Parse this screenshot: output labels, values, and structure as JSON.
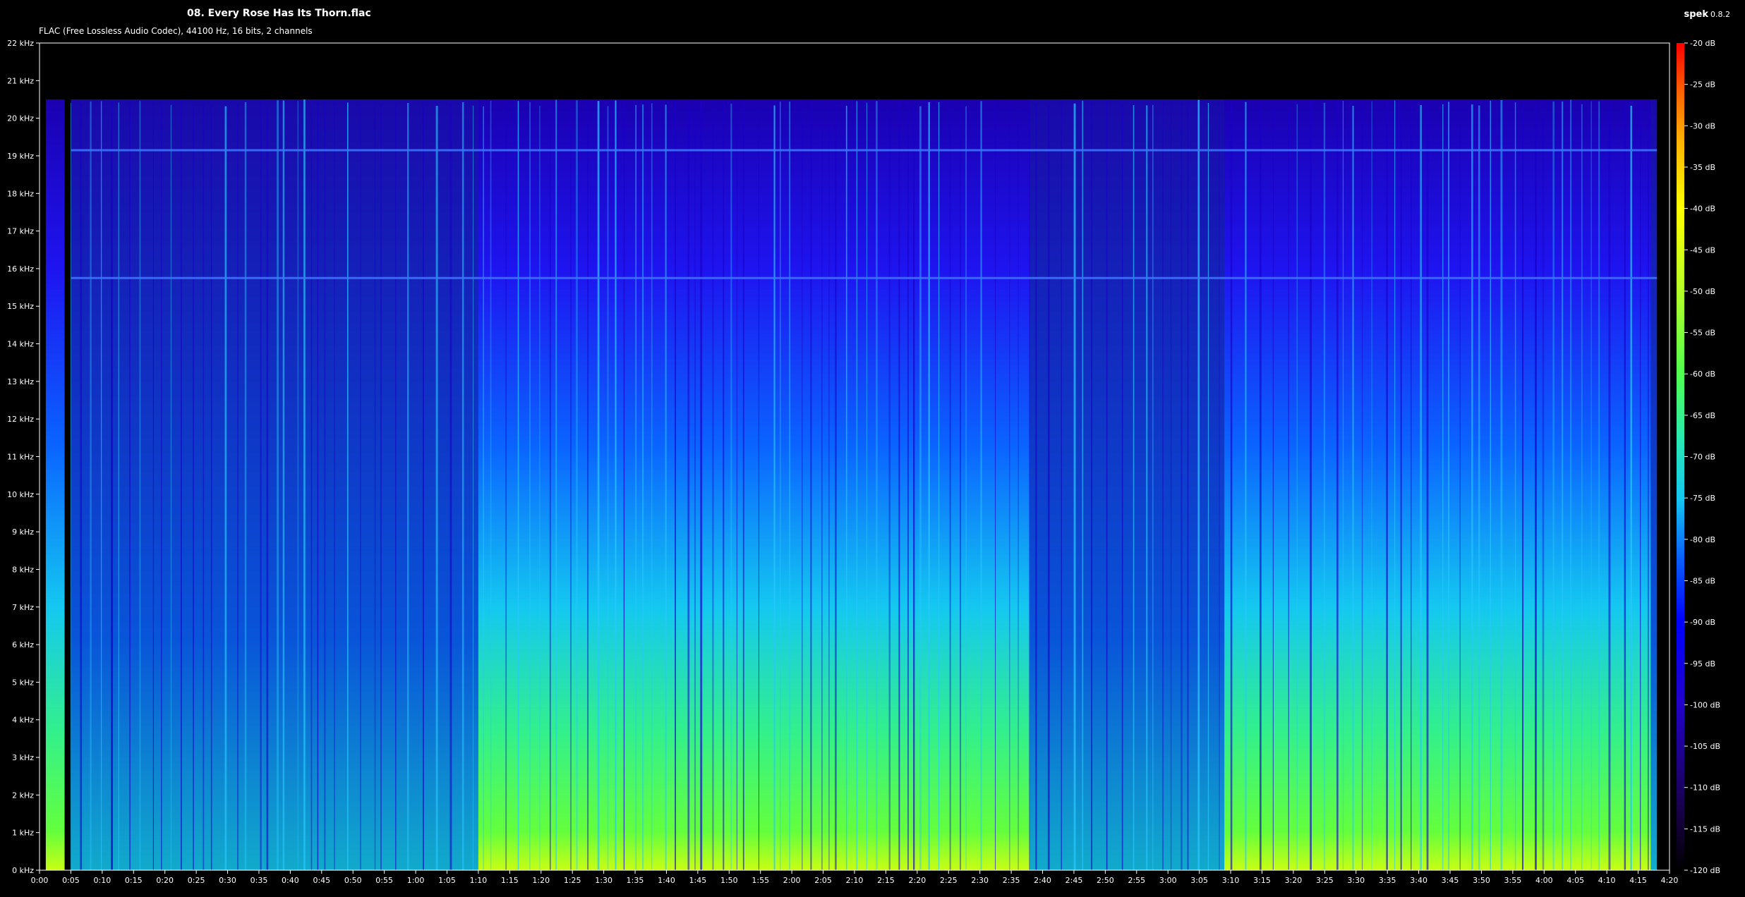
{
  "file_title": "08. Every Rose Has Its Thorn.flac",
  "file_info": "FLAC (Free Lossless Audio Codec), 44100 Hz, 16 bits, 2 channels",
  "app": {
    "name": "spek",
    "version": "0.8.2"
  },
  "colors": {
    "background": "#000000",
    "axis": "#ffffff"
  },
  "chart_data": {
    "type": "heatmap",
    "x_unit": "seconds",
    "x_ticks": [
      "0:00",
      "0:05",
      "0:10",
      "0:15",
      "0:20",
      "0:25",
      "0:30",
      "0:35",
      "0:40",
      "0:45",
      "0:50",
      "0:55",
      "1:00",
      "1:05",
      "1:10",
      "1:15",
      "1:20",
      "1:25",
      "1:30",
      "1:35",
      "1:40",
      "1:45",
      "1:50",
      "1:55",
      "2:00",
      "2:05",
      "2:10",
      "2:15",
      "2:20",
      "2:25",
      "2:30",
      "2:35",
      "2:40",
      "2:45",
      "2:50",
      "2:55",
      "3:00",
      "3:05",
      "3:10",
      "3:15",
      "3:20",
      "3:25",
      "3:30",
      "3:35",
      "3:40",
      "3:45",
      "3:50",
      "3:55",
      "4:00",
      "4:05",
      "4:10",
      "4:15",
      "4:20"
    ],
    "xlim": [
      0,
      260
    ],
    "y_ticks": [
      "0 kHz",
      "1 kHz",
      "2 kHz",
      "3 kHz",
      "4 kHz",
      "5 kHz",
      "6 kHz",
      "7 kHz",
      "8 kHz",
      "9 kHz",
      "10 kHz",
      "11 kHz",
      "12 kHz",
      "13 kHz",
      "14 kHz",
      "15 kHz",
      "16 kHz",
      "17 kHz",
      "18 kHz",
      "19 kHz",
      "20 kHz",
      "21 kHz",
      "22 kHz"
    ],
    "ylim_khz": [
      0,
      22
    ],
    "colorbar_ticks": [
      "-20 dB",
      "-25 dB",
      "-30 dB",
      "-35 dB",
      "-40 dB",
      "-45 dB",
      "-50 dB",
      "-55 dB",
      "-60 dB",
      "-65 dB",
      "-70 dB",
      "-75 dB",
      "-80 dB",
      "-85 dB",
      "-90 dB",
      "-95 dB",
      "-100 dB",
      "-105 dB",
      "-110 dB",
      "-115 dB",
      "-120 dB"
    ],
    "colorbar_range_db": [
      -120,
      -20
    ],
    "colormap": [
      "#000000",
      "#1a0050",
      "#2200c8",
      "#0000ff",
      "#0a64ff",
      "#14c8f0",
      "#28e8b4",
      "#50ff50",
      "#b4ff28",
      "#ffff00",
      "#ffb400",
      "#ff6400",
      "#ff0000"
    ],
    "spectral_cutoff_khz": 20.5,
    "horizontal_lines_khz": [
      15.75,
      19.15
    ],
    "loud_sections_sec": [
      [
        1,
        4
      ],
      [
        70,
        158
      ],
      [
        189,
        257
      ]
    ]
  }
}
